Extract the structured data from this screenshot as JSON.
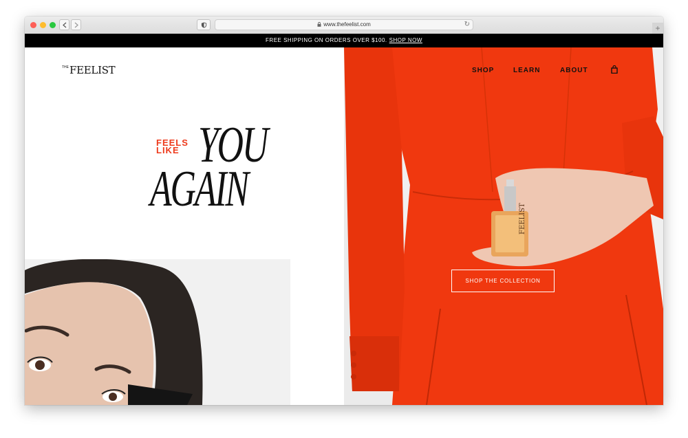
{
  "browser": {
    "url": "www.thefeelist.com"
  },
  "announcement": {
    "text": "FREE SHIPPING ON ORDERS OVER $100.",
    "link": "SHOP NOW"
  },
  "brand": {
    "logo_small": "THE",
    "logo_main": "FEELIST"
  },
  "hero": {
    "tagline_1": "FEELS",
    "tagline_2": "LIKE",
    "headline_1": "YOU",
    "headline_2": "AGAIN",
    "cta": "SHOP THE COLLECTION",
    "bottle_label": "FEELIST"
  },
  "nav": {
    "items": [
      "SHOP",
      "LEARN",
      "ABOUT"
    ]
  },
  "colors": {
    "accent": "#ee3a1c",
    "dress": "#f0380f",
    "bar": "#000000"
  }
}
